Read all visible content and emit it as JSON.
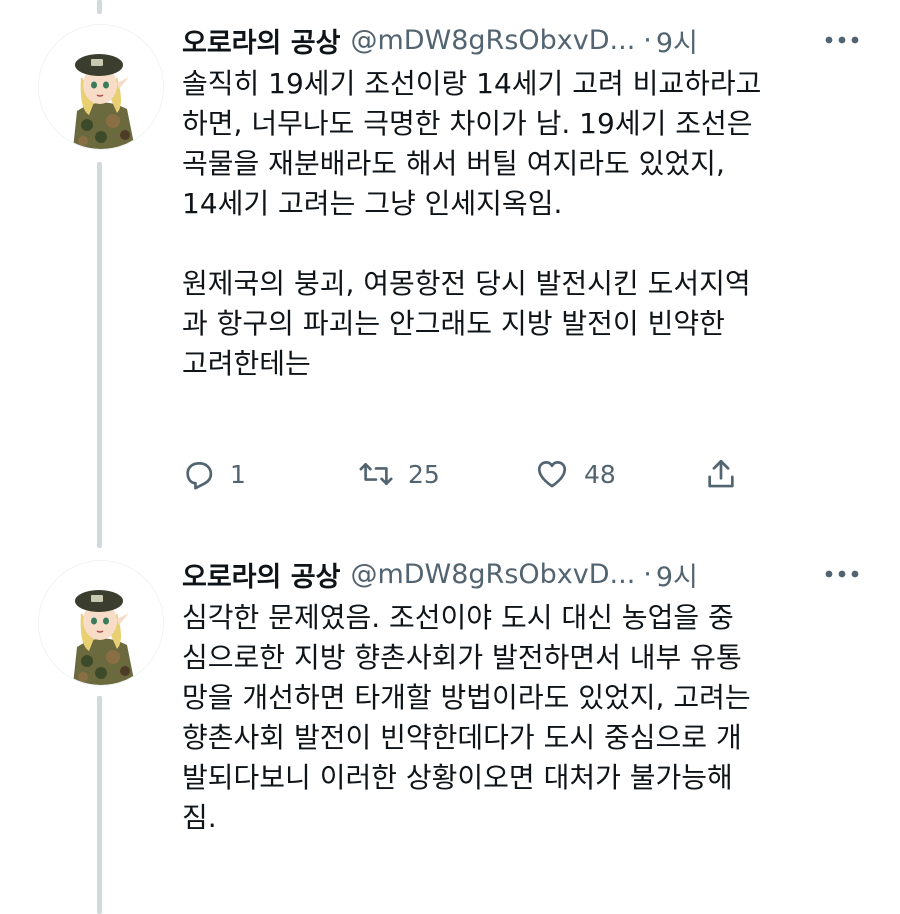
{
  "tweets": [
    {
      "display_name": "오로라의 공상",
      "handle": "@mDW8gRsObxvD...",
      "separator": "·",
      "time": "9시",
      "text": "솔직히 19세기 조선이랑 14세기 고려 비교하라고\n하면, 너무나도 극명한 차이가 남. 19세기 조선은\n곡물을 재분배라도 해서 버틸 여지라도 있었지,\n14세기 고려는 그냥 인세지옥임.\n\n원제국의 붕괴, 여몽항전 당시 발전시킨 도서지역\n과 항구의 파괴는 안그래도 지방 발전이 빈약한\n고려한테는",
      "reply_count": "1",
      "retweet_count": "25",
      "like_count": "48"
    },
    {
      "display_name": "오로라의 공상",
      "handle": "@mDW8gRsObxvD...",
      "separator": "·",
      "time": "9시",
      "text": "심각한 문제였음. 조선이야 도시 대신 농업을 중\n심으로한 지방 향촌사회가 발전하면서 내부 유통\n망을 개선하면 타개할 방법이라도 있었지, 고려는\n향촌사회 발전이 빈약한데다가 도시 중심으로 개\n발되다보니 이러한 상황이오면 대처가 불가능해\n짐."
    }
  ],
  "colors": {
    "text": "#0f1419",
    "secondary": "#536471",
    "thread_line": "#cfd9de"
  },
  "icons": {
    "avatar": "soldier-avatar",
    "more": "more-dots-icon",
    "reply": "reply-icon",
    "retweet": "retweet-icon",
    "like": "heart-icon",
    "share": "share-icon"
  }
}
